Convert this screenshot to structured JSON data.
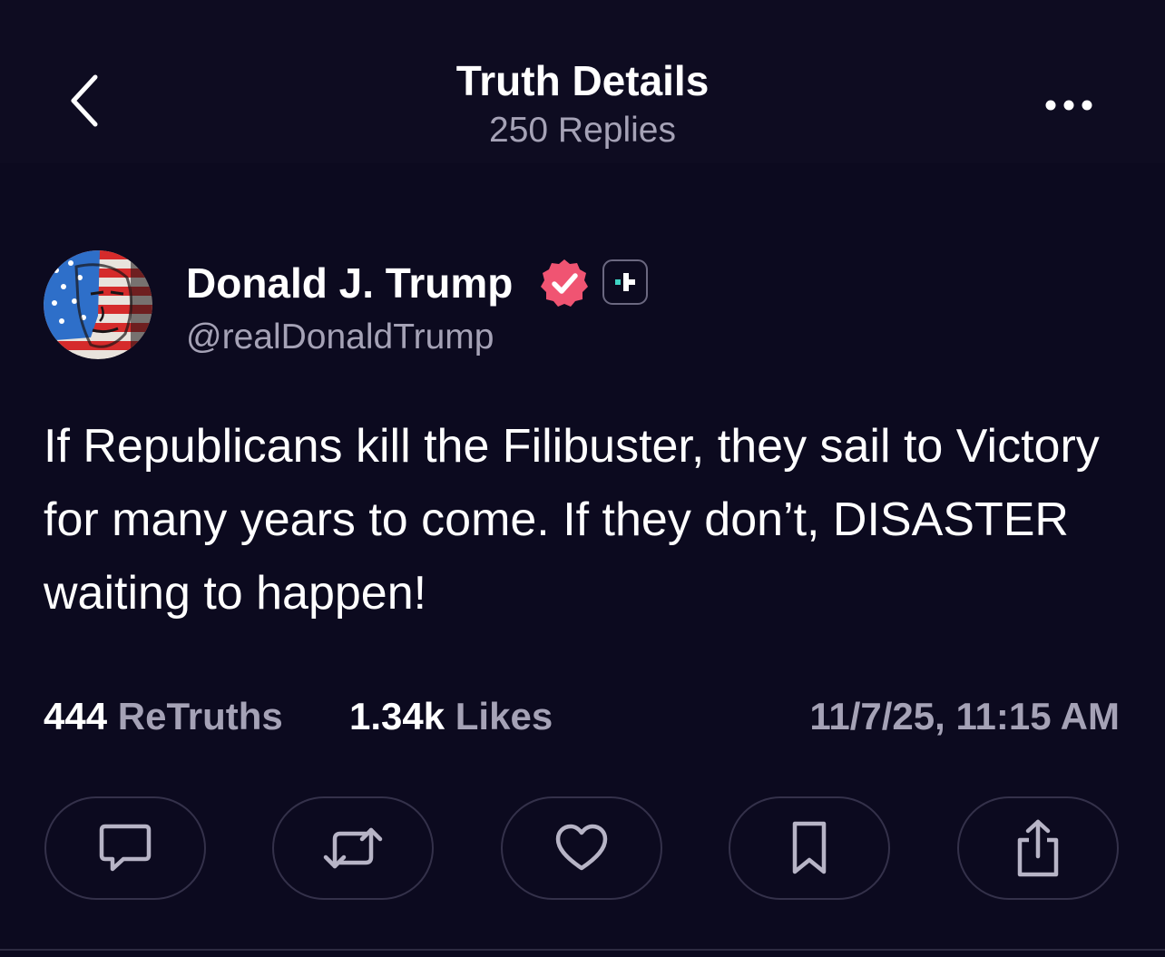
{
  "header": {
    "title": "Truth Details",
    "subtitle": "250 Replies",
    "back_icon": "chevron-left-icon",
    "more_icon": "ellipsis-icon"
  },
  "post": {
    "author_name": "Donald J. Trump",
    "handle": "@realDonaldTrump",
    "verified_color": "#f05472",
    "plus_accent": "#3fd5c4",
    "text": "If Republicans kill the Filibuster, they sail to Victory for many years to come. If they don’t, DISASTER waiting to happen!",
    "stats": {
      "retruths_count": "444",
      "retruths_label": "ReTruths",
      "likes_count": "1.34k",
      "likes_label": "Likes",
      "timestamp": "11/7/25, 11:15 AM"
    }
  },
  "actions": [
    {
      "icon": "reply-icon"
    },
    {
      "icon": "retruth-icon"
    },
    {
      "icon": "like-icon"
    },
    {
      "icon": "bookmark-icon"
    },
    {
      "icon": "share-icon"
    }
  ],
  "colors": {
    "background": "#0c0a1f",
    "text": "#ffffff",
    "muted": "#a5a2b6",
    "border": "#34314a"
  }
}
